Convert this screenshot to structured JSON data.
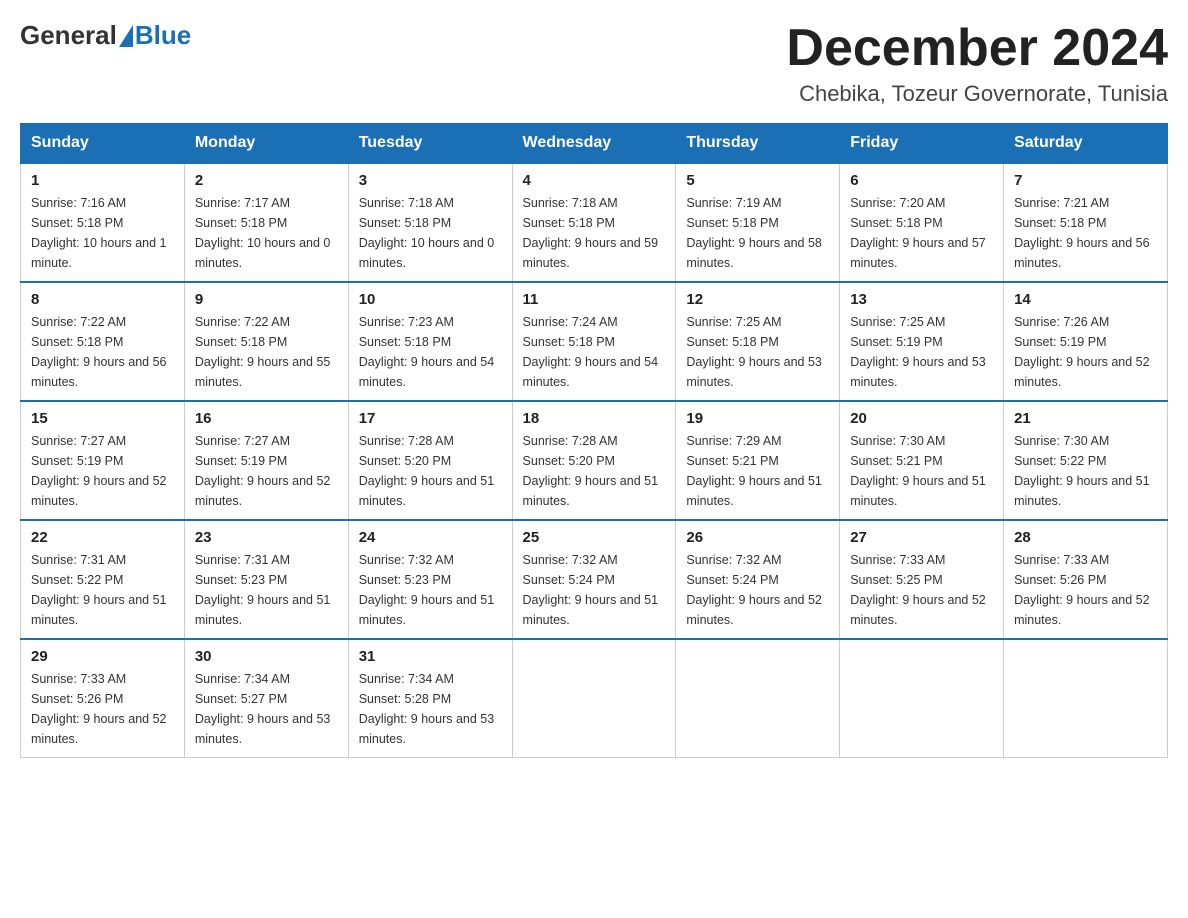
{
  "header": {
    "logo": {
      "general": "General",
      "blue": "Blue"
    },
    "title": "December 2024",
    "subtitle": "Chebika, Tozeur Governorate, Tunisia"
  },
  "weekdays": [
    "Sunday",
    "Monday",
    "Tuesday",
    "Wednesday",
    "Thursday",
    "Friday",
    "Saturday"
  ],
  "weeks": [
    [
      {
        "day": "1",
        "sunrise": "7:16 AM",
        "sunset": "5:18 PM",
        "daylight": "10 hours and 1 minute."
      },
      {
        "day": "2",
        "sunrise": "7:17 AM",
        "sunset": "5:18 PM",
        "daylight": "10 hours and 0 minutes."
      },
      {
        "day": "3",
        "sunrise": "7:18 AM",
        "sunset": "5:18 PM",
        "daylight": "10 hours and 0 minutes."
      },
      {
        "day": "4",
        "sunrise": "7:18 AM",
        "sunset": "5:18 PM",
        "daylight": "9 hours and 59 minutes."
      },
      {
        "day": "5",
        "sunrise": "7:19 AM",
        "sunset": "5:18 PM",
        "daylight": "9 hours and 58 minutes."
      },
      {
        "day": "6",
        "sunrise": "7:20 AM",
        "sunset": "5:18 PM",
        "daylight": "9 hours and 57 minutes."
      },
      {
        "day": "7",
        "sunrise": "7:21 AM",
        "sunset": "5:18 PM",
        "daylight": "9 hours and 56 minutes."
      }
    ],
    [
      {
        "day": "8",
        "sunrise": "7:22 AM",
        "sunset": "5:18 PM",
        "daylight": "9 hours and 56 minutes."
      },
      {
        "day": "9",
        "sunrise": "7:22 AM",
        "sunset": "5:18 PM",
        "daylight": "9 hours and 55 minutes."
      },
      {
        "day": "10",
        "sunrise": "7:23 AM",
        "sunset": "5:18 PM",
        "daylight": "9 hours and 54 minutes."
      },
      {
        "day": "11",
        "sunrise": "7:24 AM",
        "sunset": "5:18 PM",
        "daylight": "9 hours and 54 minutes."
      },
      {
        "day": "12",
        "sunrise": "7:25 AM",
        "sunset": "5:18 PM",
        "daylight": "9 hours and 53 minutes."
      },
      {
        "day": "13",
        "sunrise": "7:25 AM",
        "sunset": "5:19 PM",
        "daylight": "9 hours and 53 minutes."
      },
      {
        "day": "14",
        "sunrise": "7:26 AM",
        "sunset": "5:19 PM",
        "daylight": "9 hours and 52 minutes."
      }
    ],
    [
      {
        "day": "15",
        "sunrise": "7:27 AM",
        "sunset": "5:19 PM",
        "daylight": "9 hours and 52 minutes."
      },
      {
        "day": "16",
        "sunrise": "7:27 AM",
        "sunset": "5:19 PM",
        "daylight": "9 hours and 52 minutes."
      },
      {
        "day": "17",
        "sunrise": "7:28 AM",
        "sunset": "5:20 PM",
        "daylight": "9 hours and 51 minutes."
      },
      {
        "day": "18",
        "sunrise": "7:28 AM",
        "sunset": "5:20 PM",
        "daylight": "9 hours and 51 minutes."
      },
      {
        "day": "19",
        "sunrise": "7:29 AM",
        "sunset": "5:21 PM",
        "daylight": "9 hours and 51 minutes."
      },
      {
        "day": "20",
        "sunrise": "7:30 AM",
        "sunset": "5:21 PM",
        "daylight": "9 hours and 51 minutes."
      },
      {
        "day": "21",
        "sunrise": "7:30 AM",
        "sunset": "5:22 PM",
        "daylight": "9 hours and 51 minutes."
      }
    ],
    [
      {
        "day": "22",
        "sunrise": "7:31 AM",
        "sunset": "5:22 PM",
        "daylight": "9 hours and 51 minutes."
      },
      {
        "day": "23",
        "sunrise": "7:31 AM",
        "sunset": "5:23 PM",
        "daylight": "9 hours and 51 minutes."
      },
      {
        "day": "24",
        "sunrise": "7:32 AM",
        "sunset": "5:23 PM",
        "daylight": "9 hours and 51 minutes."
      },
      {
        "day": "25",
        "sunrise": "7:32 AM",
        "sunset": "5:24 PM",
        "daylight": "9 hours and 51 minutes."
      },
      {
        "day": "26",
        "sunrise": "7:32 AM",
        "sunset": "5:24 PM",
        "daylight": "9 hours and 52 minutes."
      },
      {
        "day": "27",
        "sunrise": "7:33 AM",
        "sunset": "5:25 PM",
        "daylight": "9 hours and 52 minutes."
      },
      {
        "day": "28",
        "sunrise": "7:33 AM",
        "sunset": "5:26 PM",
        "daylight": "9 hours and 52 minutes."
      }
    ],
    [
      {
        "day": "29",
        "sunrise": "7:33 AM",
        "sunset": "5:26 PM",
        "daylight": "9 hours and 52 minutes."
      },
      {
        "day": "30",
        "sunrise": "7:34 AM",
        "sunset": "5:27 PM",
        "daylight": "9 hours and 53 minutes."
      },
      {
        "day": "31",
        "sunrise": "7:34 AM",
        "sunset": "5:28 PM",
        "daylight": "9 hours and 53 minutes."
      },
      null,
      null,
      null,
      null
    ]
  ]
}
